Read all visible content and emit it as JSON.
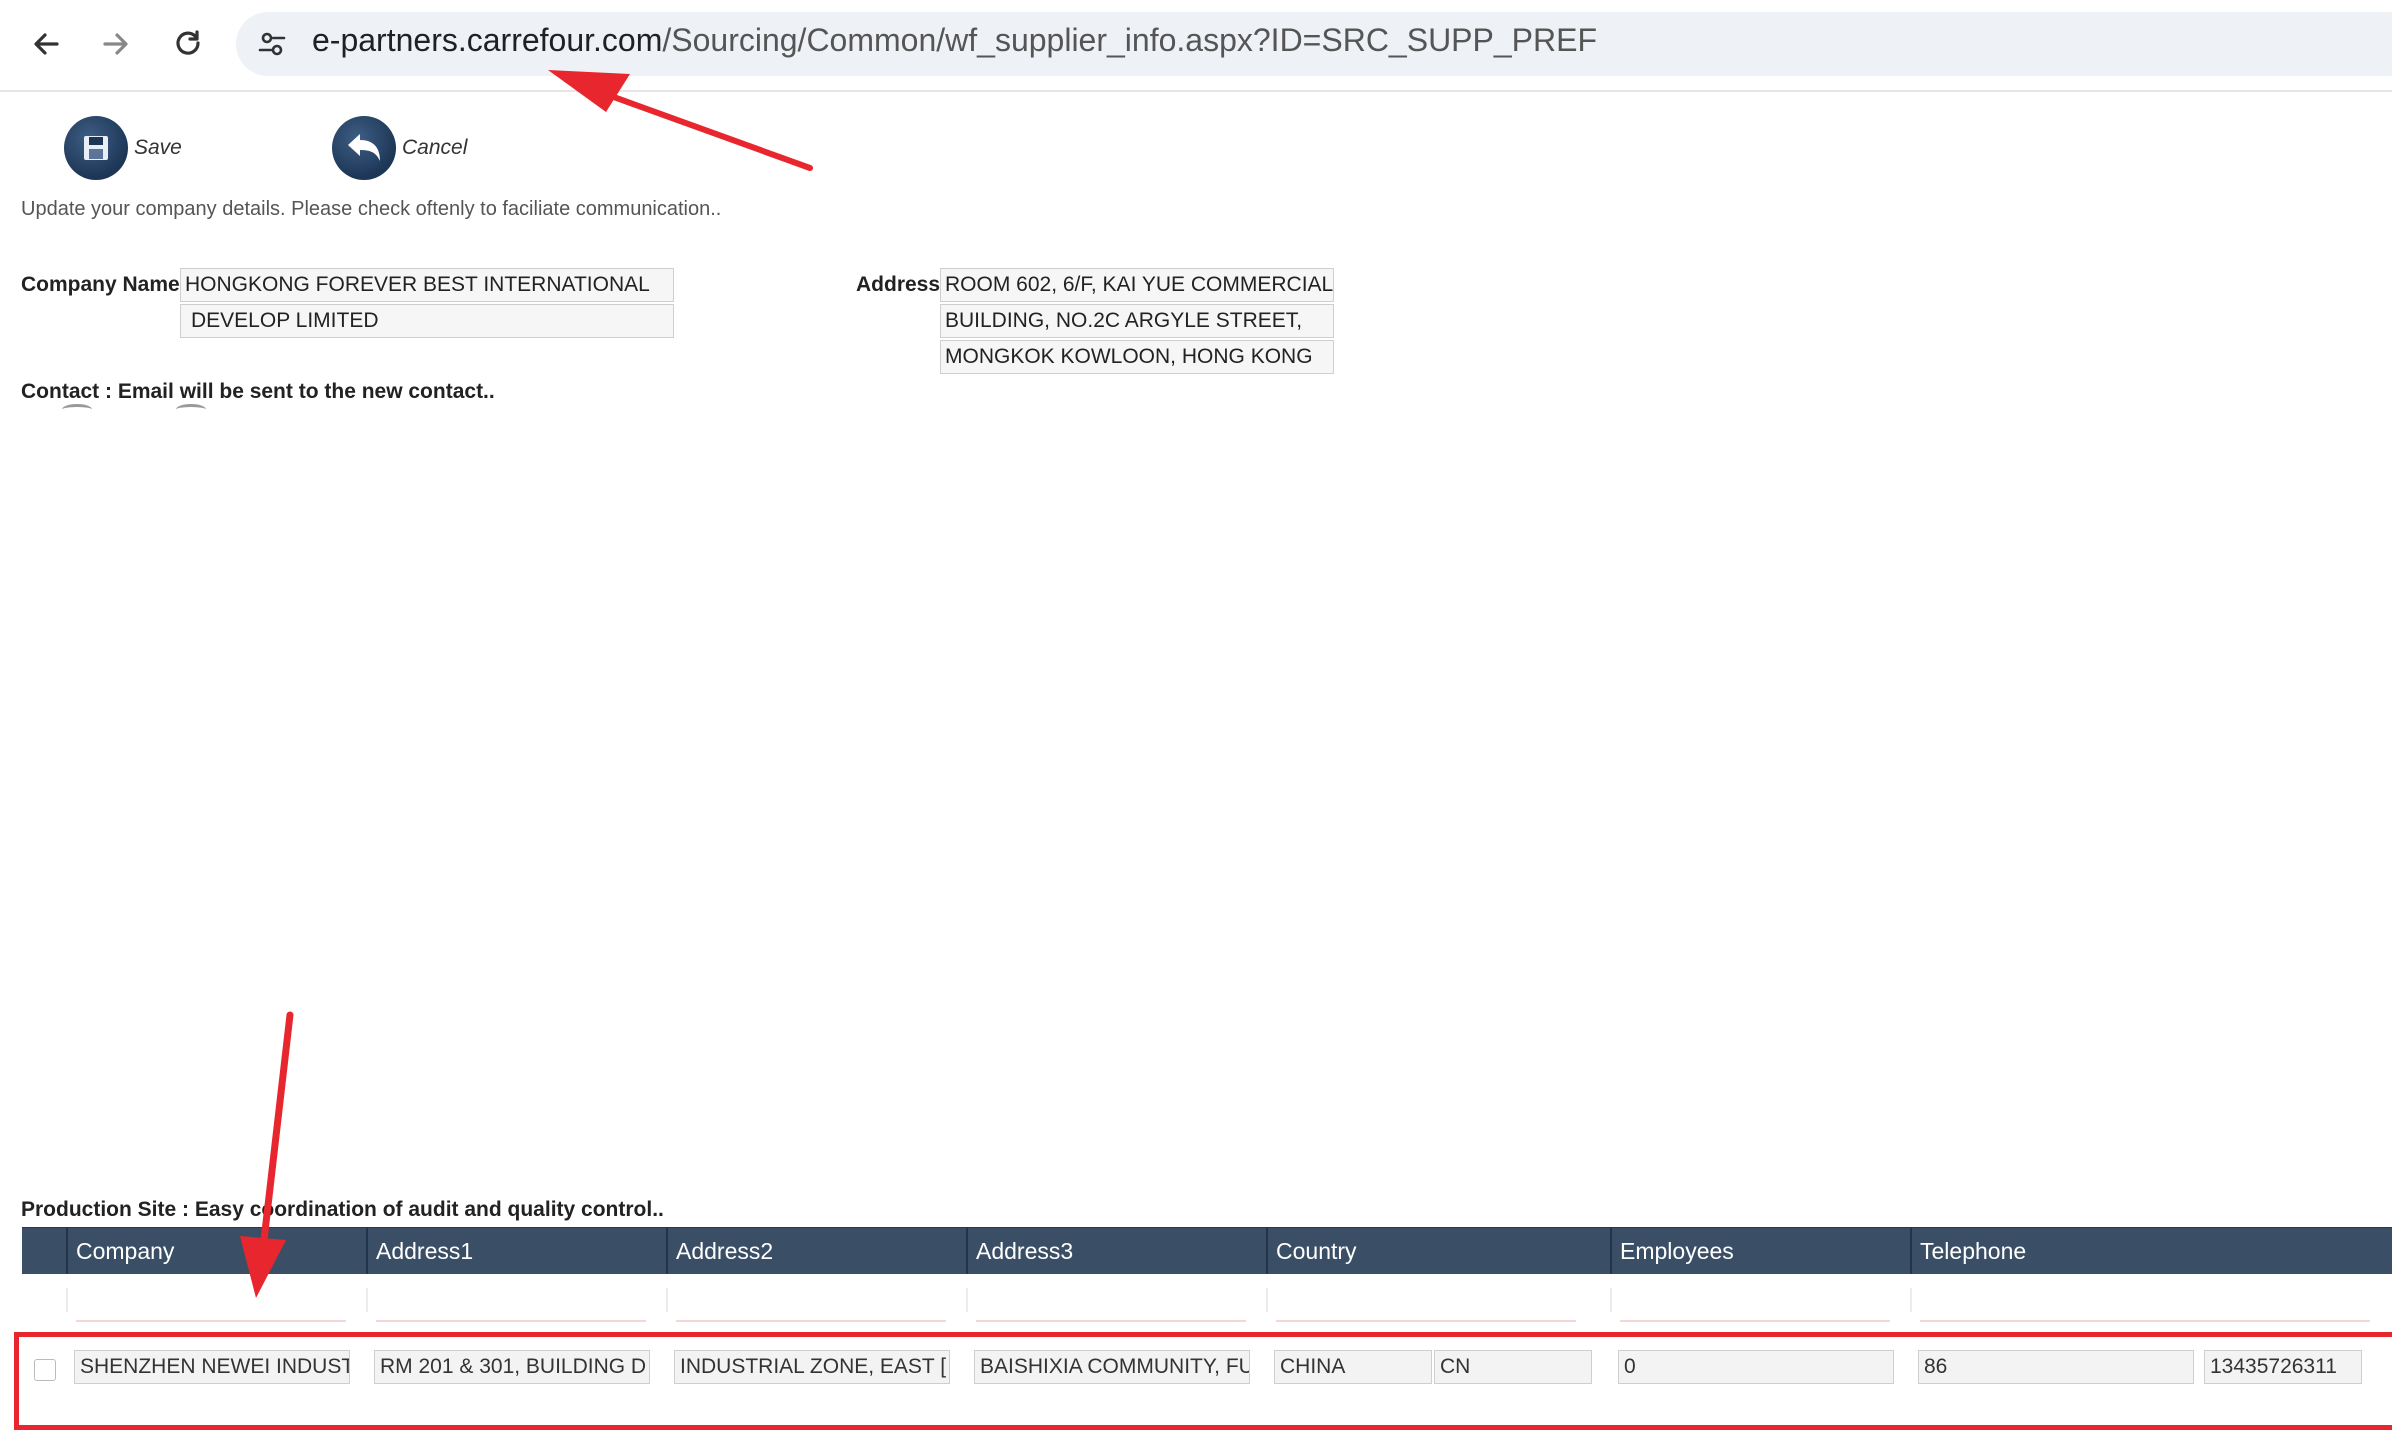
{
  "browser": {
    "back_icon": "arrow-left-icon",
    "forward_icon": "arrow-right-icon",
    "reload_icon": "reload-icon",
    "site_info_icon": "tune-icon",
    "url_host": "e-partners.carrefour.com",
    "url_path": "/Sourcing/Common/wf_supplier_info.aspx?ID=SRC_SUPP_PREF"
  },
  "toolbar": {
    "save_label": "Save",
    "cancel_label": "Cancel",
    "save_icon": "floppy-disk-icon",
    "cancel_icon": "undo-arrow-icon"
  },
  "intro_text": "Update your company details. Please check oftenly to faciliate communication..",
  "company": {
    "name_label": "Company Name",
    "name_line1": "HONGKONG FOREVER BEST INTERNATIONAL",
    "name_line2": "DEVELOP LIMITED",
    "address_label": "Address",
    "address_line1": "ROOM 602, 6/F, KAI YUE COMMERCIAL",
    "address_line2": "BUILDING, NO.2C ARGYLE STREET,",
    "address_line3": "MONGKOK KOWLOON, HONG KONG"
  },
  "contact_text": "Contact : Email will be sent to the new contact..",
  "production": {
    "label": "Production Site : Easy coordination of audit and quality control..",
    "columns": [
      "Company",
      "Address1",
      "Address2",
      "Address3",
      "Country",
      "Employees",
      "Telephone"
    ],
    "row": {
      "company": "SHENZHEN NEWEI INDUST",
      "address1": "RM 201 & 301, BUILDING D",
      "address2": "INDUSTRIAL ZONE, EAST [",
      "address3": "BAISHIXIA COMMUNITY, FU",
      "country": "CHINA",
      "country_code": "CN",
      "employees": "0",
      "phone_prefix": "86",
      "telephone": "13435726311"
    }
  },
  "annotation_color": "#e8262e"
}
